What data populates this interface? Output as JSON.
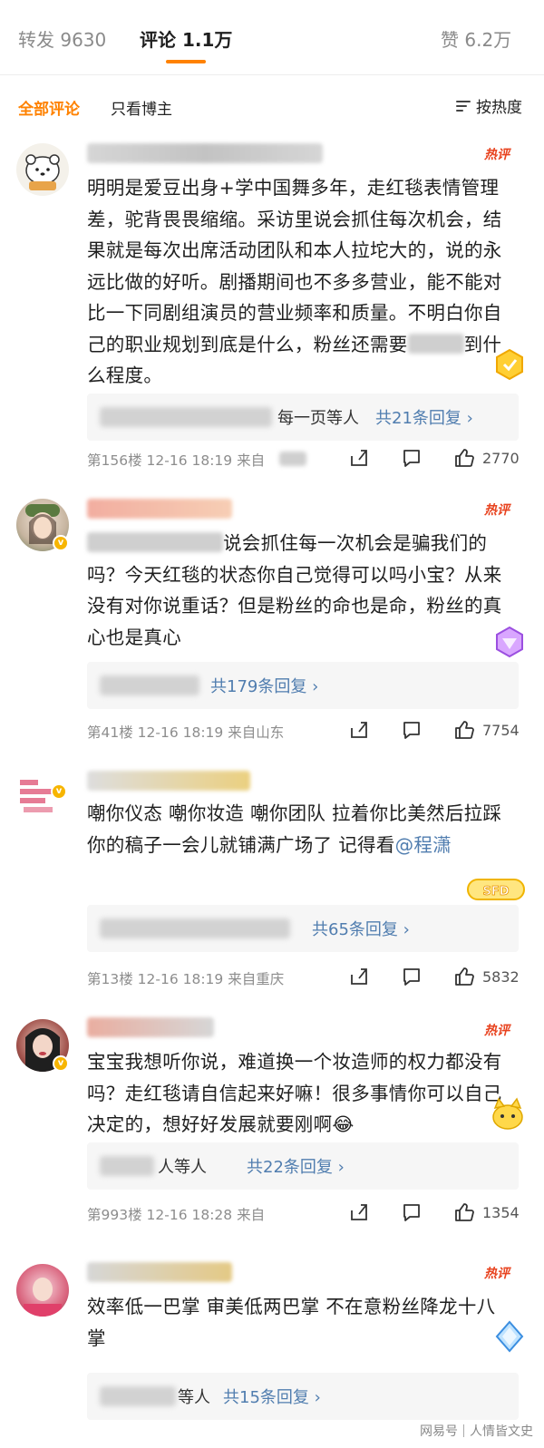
{
  "tabs": {
    "repost": "转发 9630",
    "comments": "评论 1.1万",
    "likes": "赞 6.2万"
  },
  "filter": {
    "all": "全部评论",
    "author_only": "只看博主",
    "sort": "按热度"
  },
  "hot_label": "热评",
  "colors": {
    "accent": "#ff8200",
    "link": "#507daf",
    "hot": "#e8431f"
  },
  "comments": [
    {
      "text_a": "明明是爱豆出身+学中国舞多年，走红毯表情管理差，驼背畏畏缩缩。采访里说会抓住每次机会，结果就是每次出席活动团队和本人拉坨大的，说的永远比做的好听。剧播期间也不多多营业，能不能对比一下同剧组演员的营业频率和质量。不明白你自己的职业规划到底是什么，粉丝还需要",
      "text_b": "到什么程度。",
      "reply_text": "每一页等人",
      "reply_count": "共21条回复",
      "meta": "第156楼  12-16 18:19  来自",
      "likes": "2770"
    },
    {
      "text_a": "说会抓住每一次机会是骗我们的吗？今天红毯的状态你自己觉得可以吗小宝？从来没有对你说重话？但是粉丝的命也是命，粉丝的真心也是真心",
      "text_b": "",
      "reply_text": "",
      "reply_count": "共179条回复",
      "meta": "第41楼  12-16 18:19  来自山东",
      "likes": "7754"
    },
    {
      "text_a": "嘲你仪态 嘲你妆造 嘲你团队 拉着你比美然后拉踩你的稿子一会儿就铺满广场了 记得看",
      "mention": "@程潇",
      "text_b": "",
      "reply_text": "",
      "reply_count": "共65条回复",
      "meta": "第13楼  12-16 18:19  来自重庆",
      "likes": "5832"
    },
    {
      "text_a": "宝宝我想听你说，难道换一个妆造师的权力都没有吗？走红毯请自信起来好嘛！很多事情你可以自己决定的，想好好发展就要刚啊",
      "text_b": "",
      "reply_text": "人等人",
      "reply_count": "共22条回复",
      "meta": "第993楼  12-16 18:28  来自",
      "likes": "1354"
    },
    {
      "text_a": "效率低一巴掌 审美低两巴掌 不在意粉丝降龙十八掌",
      "text_b": "",
      "reply_text": "等人",
      "reply_count": "共15条回复",
      "meta": "",
      "likes": ""
    }
  ],
  "watermark": {
    "brand": "网易号",
    "author": "人情皆文史"
  },
  "icons": [
    "sort-icon",
    "share-icon",
    "comment-icon",
    "thumbs-up-icon",
    "chevron-right-icon"
  ]
}
